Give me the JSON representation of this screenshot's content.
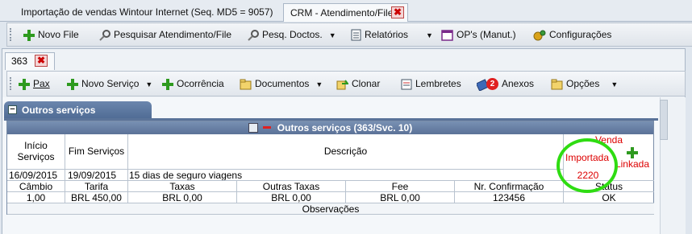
{
  "window_tabs": [
    {
      "label": "Importação de vendas Wintour Internet (Seq. MD5 = 9057)"
    },
    {
      "label": "CRM - Atendimento/File"
    }
  ],
  "close_glyph": "✖",
  "main_toolbar": {
    "novo_file": "Novo File",
    "pesquisar": "Pesquisar Atendimento/File",
    "pesq_doctos": "Pesq. Doctos.",
    "relatorios": "Relatórios",
    "ops": "OP's (Manut.)",
    "configuracoes": "Configurações"
  },
  "sub_tab": {
    "label": "363"
  },
  "sub_toolbar": {
    "pax": "Pax",
    "novo_servico": "Novo Serviço",
    "ocorrencia": "Ocorrência",
    "documentos": "Documentos",
    "clonar": "Clonar",
    "lembretes": "Lembretes",
    "anexos_badge": "2",
    "anexos": "Anexos",
    "opcoes": "Opções"
  },
  "group": {
    "title": "Outros serviços"
  },
  "table": {
    "title": "Outros serviços (363/Svc. 10)",
    "headers": {
      "inicio": "Início Serviços",
      "fim": "Fim Serviços",
      "descricao": "Descrição",
      "venda": "Venda",
      "importada": "Importada",
      "linkada": "Linkada"
    },
    "row": {
      "inicio": "16/09/2015",
      "fim": "19/09/2015",
      "descricao": "15 dias de seguro viagens",
      "venda_num": "2220"
    },
    "sub_headers": [
      "Câmbio",
      "Tarifa",
      "Taxas",
      "Outras Taxas",
      "Fee",
      "Nr. Confirmação",
      "Status"
    ],
    "sub_values": [
      "1,00",
      "BRL 450,00",
      "BRL 0,00",
      "BRL 0,00",
      "BRL 0,00",
      "123456",
      "OK"
    ],
    "observacoes": "Observações"
  },
  "colors": {
    "accent": "#5b7298",
    "highlight_circle": "#2fdc12",
    "badge": "#e02020"
  }
}
